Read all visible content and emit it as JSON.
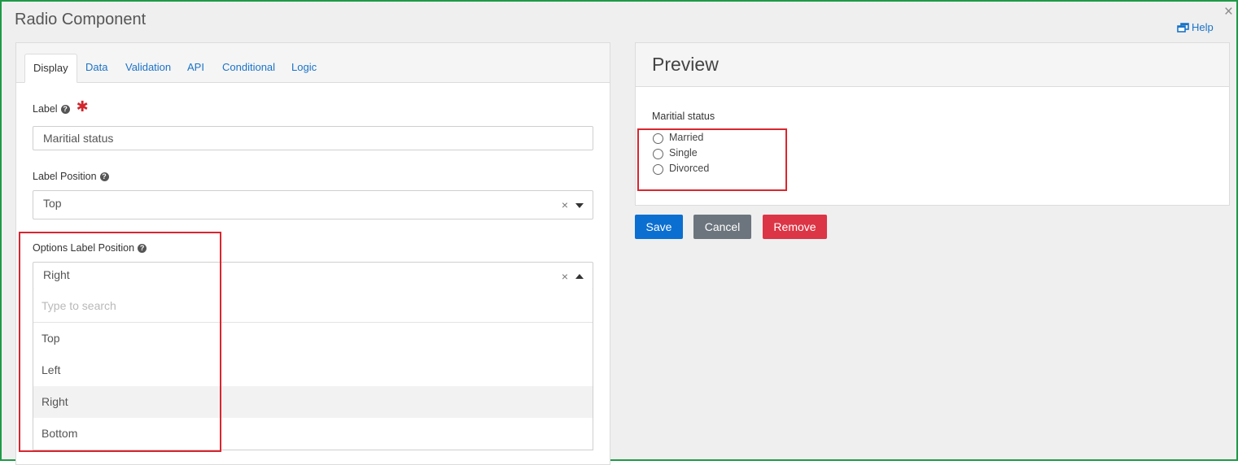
{
  "dialog": {
    "title": "Radio Component",
    "close_icon": "×",
    "help_label": "Help"
  },
  "tabs": [
    {
      "label": "Display",
      "active": true
    },
    {
      "label": "Data"
    },
    {
      "label": "Validation"
    },
    {
      "label": "API"
    },
    {
      "label": "Conditional"
    },
    {
      "label": "Logic"
    }
  ],
  "form": {
    "label_field": {
      "label": "Label",
      "required_mark": "✱",
      "value": "Maritial status"
    },
    "label_position": {
      "label": "Label Position",
      "value": "Top",
      "clear": "×"
    },
    "options_label_position": {
      "label": "Options Label Position",
      "value": "Right",
      "clear": "×",
      "search_placeholder": "Type to search",
      "options": [
        "Top",
        "Left",
        "Right",
        "Bottom"
      ],
      "highlighted": "Right"
    }
  },
  "preview": {
    "title": "Preview",
    "field_label": "Maritial status",
    "radio_options": [
      "Married",
      "Single",
      "Divorced"
    ]
  },
  "buttons": {
    "save": "Save",
    "cancel": "Cancel",
    "remove": "Remove"
  },
  "colors": {
    "frame_border": "#1e9a47",
    "link": "#1a73c8",
    "save": "#0b6fd1",
    "cancel": "#6c757d",
    "remove": "#dc3545",
    "highlight_box": "#d9262f"
  },
  "icons": {
    "help": "external-window-icon",
    "help_question": "question-circle-icon",
    "caret_down": "caret-down-icon",
    "caret_up": "caret-up-icon"
  }
}
